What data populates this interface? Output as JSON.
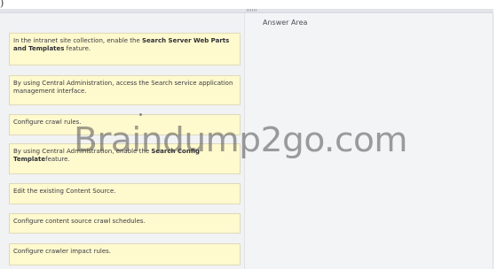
{
  "page_caption": {
    "left": ")",
    "right": "Answer Area"
  },
  "answer_area": {
    "title": "Answer Area"
  },
  "watermark": {
    "text": "Braindump2go.com"
  },
  "steps": [
    {
      "before": "In the intranet site collection, enable the ",
      "bold": "Search Server Web Parts and Templates",
      "after": " feature."
    },
    {
      "before": "By using Central Administration, access the Search service application management interface.",
      "bold": "",
      "after": ""
    },
    {
      "before": "Configure crawl rules.",
      "bold": "",
      "after": ""
    },
    {
      "before": "By using Central Administration, enable the ",
      "bold": "Search Config Template",
      "after": "feature."
    },
    {
      "before": "Edit the existing Content Source.",
      "bold": "",
      "after": ""
    },
    {
      "before": "Configure content source crawl schedules.",
      "bold": "",
      "after": ""
    },
    {
      "before": "Configure crawler impact rules.",
      "bold": "",
      "after": ""
    }
  ]
}
